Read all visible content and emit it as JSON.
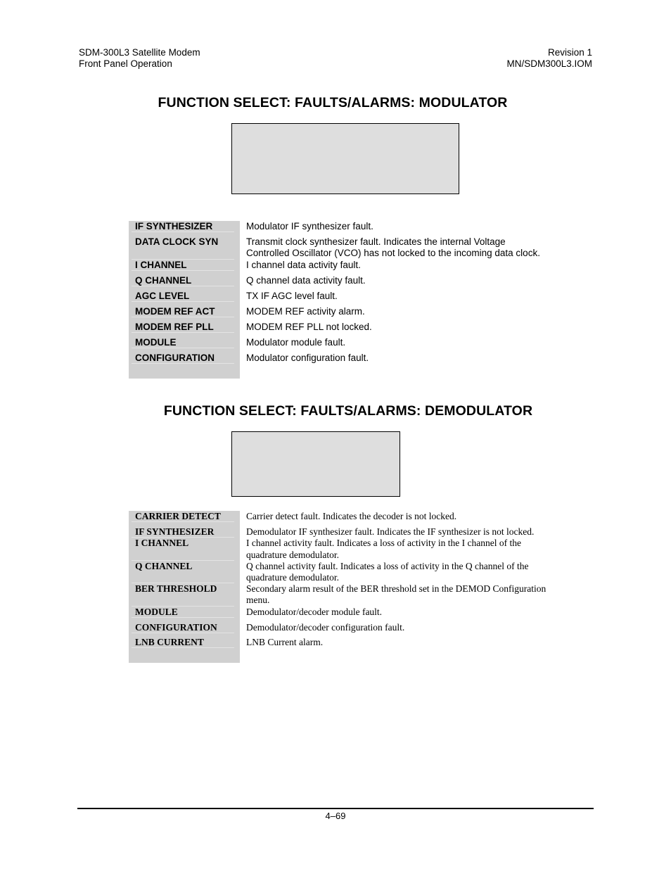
{
  "header": {
    "left": [
      "SDM-300L3 Satellite Modem",
      "Front Panel Operation"
    ],
    "right": [
      "Revision 1",
      "MN/SDM300L3.IOM"
    ]
  },
  "modulator": {
    "title": "FUNCTION SELECT: FAULTS/ALARMS: MODULATOR",
    "rows": [
      {
        "key": "IF SYNTHESIZER",
        "desc": "Modulator IF synthesizer fault."
      },
      {
        "key": "DATA CLOCK SYN",
        "desc": "Transmit clock synthesizer fault. Indicates the internal Voltage Controlled Oscillator (VCO) has not locked to the incoming data clock."
      },
      {
        "key": "I CHANNEL",
        "desc": "I channel data activity fault."
      },
      {
        "key": "Q CHANNEL",
        "desc": "Q channel data activity fault."
      },
      {
        "key": "AGC LEVEL",
        "desc": "TX IF AGC level fault."
      },
      {
        "key": "MODEM REF ACT",
        "desc": "MODEM REF activity alarm."
      },
      {
        "key": "MODEM REF PLL",
        "desc": "MODEM REF PLL not locked."
      },
      {
        "key": "MODULE",
        "desc": "Modulator module fault."
      },
      {
        "key": "CONFIGURATION",
        "desc": "Modulator configuration fault."
      }
    ]
  },
  "demodulator": {
    "title": "FUNCTION SELECT: FAULTS/ALARMS: DEMODULATOR",
    "rows": [
      {
        "key": "CARRIER DETECT",
        "desc": "Carrier detect fault. Indicates the decoder is not locked."
      },
      {
        "key": "IF SYNTHESIZER",
        "desc": "Demodulator IF synthesizer fault. Indicates the IF synthesizer is not locked."
      },
      {
        "key": "I CHANNEL",
        "desc": "I channel activity fault. Indicates a loss of activity in the I channel of the quadrature demodulator."
      },
      {
        "key": "Q CHANNEL",
        "desc": "Q channel activity fault. Indicates a loss of activity in the Q channel of the quadrature demodulator."
      },
      {
        "key": "BER THRESHOLD",
        "desc": "Secondary alarm result of the BER threshold set in the DEMOD Configuration menu."
      },
      {
        "key": "MODULE",
        "desc": "Demodulator/decoder module fault."
      },
      {
        "key": "CONFIGURATION",
        "desc": "Demodulator/decoder configuration fault."
      },
      {
        "key": "LNB CURRENT",
        "desc": "LNB Current alarm."
      }
    ]
  },
  "footer": {
    "page_number": "4–69"
  }
}
